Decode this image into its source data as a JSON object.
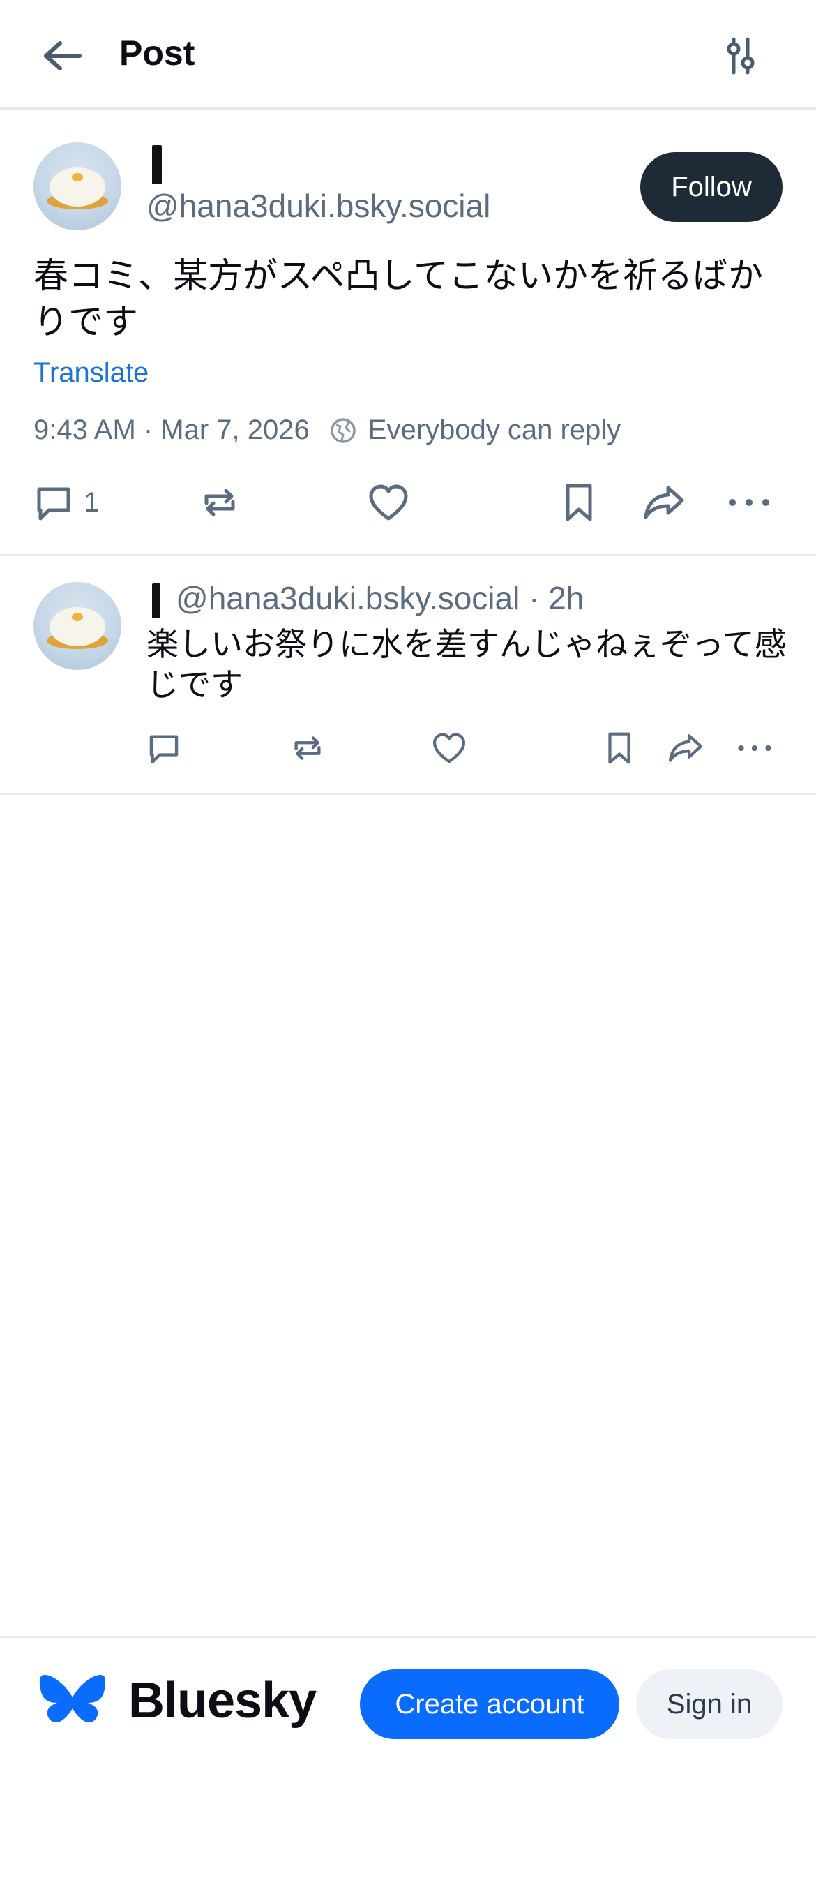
{
  "header": {
    "title": "Post",
    "back_icon": "arrow-left-icon",
    "settings_icon": "sliders-icon"
  },
  "post": {
    "handle": "@hana3duki.bsky.social",
    "follow_label": "Follow",
    "text": "春コミ、某方がスペ凸してこないかを祈るばかりです",
    "translate_label": "Translate",
    "timestamp": "9:43 AM · Mar 7, 2026",
    "reply_setting": "Everybody can reply",
    "reply_count": "1"
  },
  "reply": {
    "header": "@hana3duki.bsky.social · 2h",
    "text": "楽しいお祭りに水を差すんじゃねぇぞって感じです"
  },
  "footer": {
    "brand": "Bluesky",
    "create_account_label": "Create account",
    "sign_in_label": "Sign in"
  },
  "colors": {
    "accent": "#0a6cff",
    "link": "#1a73d6",
    "follow_bg": "#1f2a37",
    "muted": "#5b6b80"
  }
}
